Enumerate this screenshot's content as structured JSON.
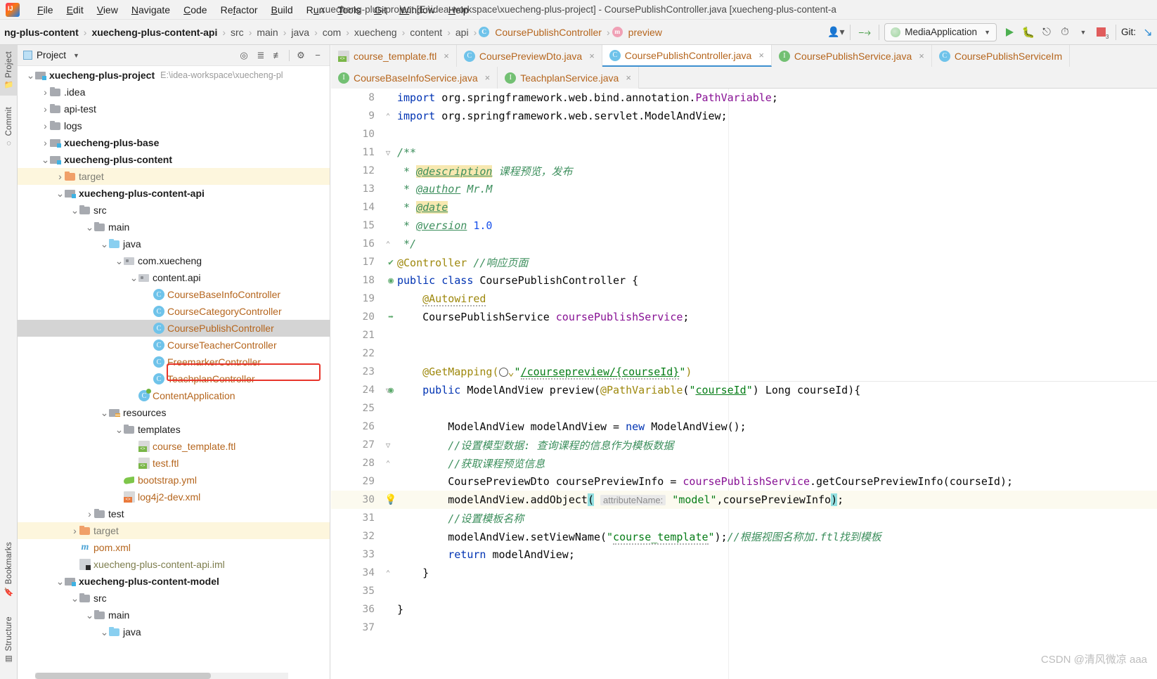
{
  "window": {
    "title": "xuecheng-plus-project [E:\\idea-workspace\\xuecheng-plus-project] - CoursePublishController.java [xuecheng-plus-content-a",
    "logo": "intellij-idea-logo"
  },
  "menubar": {
    "items": [
      "File",
      "Edit",
      "View",
      "Navigate",
      "Code",
      "Refactor",
      "Build",
      "Run",
      "Tools",
      "Git",
      "Window",
      "Help"
    ]
  },
  "breadcrumbs": [
    {
      "label": "ng-plus-content",
      "bold": true,
      "kind": "module"
    },
    {
      "label": "xuecheng-plus-content-api",
      "bold": true,
      "kind": "module"
    },
    {
      "label": "src",
      "bold": false,
      "kind": "dir"
    },
    {
      "label": "main",
      "bold": false,
      "kind": "dir"
    },
    {
      "label": "java",
      "bold": false,
      "kind": "dir"
    },
    {
      "label": "com",
      "bold": false,
      "kind": "dir"
    },
    {
      "label": "xuecheng",
      "bold": false,
      "kind": "dir"
    },
    {
      "label": "content",
      "bold": false,
      "kind": "dir"
    },
    {
      "label": "api",
      "bold": false,
      "kind": "dir"
    },
    {
      "label": "CoursePublishController",
      "bold": false,
      "kind": "class",
      "badge": "C"
    },
    {
      "label": "preview",
      "bold": false,
      "kind": "method",
      "badge": "m"
    }
  ],
  "toolbar": {
    "run_config": "MediaApplication",
    "run_button": "run-button",
    "debug_button": "debug-button",
    "coverage_button": "run-with-coverage-button",
    "profiler_button": "profiler-button",
    "stop_button": "stop-button",
    "stop_badge": "3",
    "git_label": "Git:",
    "update_project": "update-project-button",
    "user_icon": "user-avatar-icon",
    "build_icon": "build-hammer-icon"
  },
  "tool_stripe": {
    "items": [
      {
        "label": "Project",
        "active": true
      },
      {
        "label": "Commit",
        "active": false
      },
      {
        "label": "Bookmarks",
        "active": false
      },
      {
        "label": "Structure",
        "active": false
      }
    ]
  },
  "project_panel": {
    "title": "Project",
    "tools": [
      "locate-icon",
      "expand-all-icon",
      "collapse-all-icon",
      "settings-gear-icon",
      "hide-icon"
    ],
    "tree": [
      {
        "indent": 0,
        "arrow": "v",
        "icon": "module",
        "label": "xuecheng-plus-project",
        "bold": true,
        "path": "E:\\idea-workspace\\xuecheng-pl"
      },
      {
        "indent": 1,
        "arrow": ">",
        "icon": "folder",
        "label": ".idea"
      },
      {
        "indent": 1,
        "arrow": ">",
        "icon": "folder",
        "label": "api-test"
      },
      {
        "indent": 1,
        "arrow": ">",
        "icon": "folder",
        "label": "logs"
      },
      {
        "indent": 1,
        "arrow": ">",
        "icon": "module",
        "label": "xuecheng-plus-base",
        "bold": true
      },
      {
        "indent": 1,
        "arrow": "v",
        "icon": "module",
        "label": "xuecheng-plus-content",
        "bold": true
      },
      {
        "indent": 2,
        "arrow": ">",
        "icon": "folder-orange",
        "label": "target",
        "color": "grey",
        "highlight": "yellow"
      },
      {
        "indent": 2,
        "arrow": "v",
        "icon": "module",
        "label": "xuecheng-plus-content-api",
        "bold": true
      },
      {
        "indent": 3,
        "arrow": "v",
        "icon": "folder",
        "label": "src"
      },
      {
        "indent": 4,
        "arrow": "v",
        "icon": "folder",
        "label": "main"
      },
      {
        "indent": 5,
        "arrow": "v",
        "icon": "folder-blue",
        "label": "java"
      },
      {
        "indent": 6,
        "arrow": "v",
        "icon": "package",
        "label": "com.xuecheng"
      },
      {
        "indent": 7,
        "arrow": "v",
        "icon": "package",
        "label": "content.api"
      },
      {
        "indent": 8,
        "arrow": "",
        "icon": "class",
        "label": "CourseBaseInfoController",
        "color": "orange"
      },
      {
        "indent": 8,
        "arrow": "",
        "icon": "class",
        "label": "CourseCategoryController",
        "color": "orange"
      },
      {
        "indent": 8,
        "arrow": "",
        "icon": "class",
        "label": "CoursePublishController",
        "color": "orange",
        "selected": true,
        "boxed": true
      },
      {
        "indent": 8,
        "arrow": "",
        "icon": "class",
        "label": "CourseTeacherController",
        "color": "orange"
      },
      {
        "indent": 8,
        "arrow": "",
        "icon": "class",
        "label": "FreemarkerController",
        "color": "orange"
      },
      {
        "indent": 8,
        "arrow": "",
        "icon": "class",
        "label": "TeachplanController",
        "color": "orange"
      },
      {
        "indent": 7,
        "arrow": "",
        "icon": "spring-class",
        "label": "ContentApplication",
        "color": "orange"
      },
      {
        "indent": 5,
        "arrow": "v",
        "icon": "resources",
        "label": "resources"
      },
      {
        "indent": 6,
        "arrow": "v",
        "icon": "folder",
        "label": "templates"
      },
      {
        "indent": 7,
        "arrow": "",
        "icon": "ftl",
        "label": "course_template.ftl",
        "color": "orange"
      },
      {
        "indent": 7,
        "arrow": "",
        "icon": "ftl",
        "label": "test.ftl",
        "color": "orange"
      },
      {
        "indent": 6,
        "arrow": "",
        "icon": "yml",
        "label": "bootstrap.yml",
        "color": "orange"
      },
      {
        "indent": 6,
        "arrow": "",
        "icon": "ftl-orange",
        "label": "log4j2-dev.xml",
        "color": "orange"
      },
      {
        "indent": 4,
        "arrow": ">",
        "icon": "folder",
        "label": "test"
      },
      {
        "indent": 3,
        "arrow": ">",
        "icon": "folder-orange",
        "label": "target",
        "color": "grey",
        "highlight": "yellow"
      },
      {
        "indent": 3,
        "arrow": "",
        "icon": "maven",
        "label": "pom.xml",
        "color": "orange"
      },
      {
        "indent": 3,
        "arrow": "",
        "icon": "iml",
        "label": "xuecheng-plus-content-api.iml",
        "color": "olive"
      },
      {
        "indent": 2,
        "arrow": "v",
        "icon": "module",
        "label": "xuecheng-plus-content-model",
        "bold": true
      },
      {
        "indent": 3,
        "arrow": "v",
        "icon": "folder",
        "label": "src"
      },
      {
        "indent": 4,
        "arrow": "v",
        "icon": "folder",
        "label": "main"
      },
      {
        "indent": 5,
        "arrow": "v",
        "icon": "folder-blue",
        "label": "java"
      }
    ]
  },
  "editor_tabs": {
    "row1": [
      {
        "label": "course_template.ftl",
        "icon": "ftl",
        "active": false,
        "close": "×"
      },
      {
        "label": "CoursePreviewDto.java",
        "icon": "class",
        "active": false,
        "close": "×"
      },
      {
        "label": "CoursePublishController.java",
        "icon": "class",
        "active": true,
        "close": "×"
      },
      {
        "label": "CoursePublishService.java",
        "icon": "interface",
        "active": false,
        "close": "×"
      },
      {
        "label": "CoursePublishServiceIm",
        "icon": "class",
        "active": false,
        "close": ""
      }
    ],
    "row2": [
      {
        "label": "CourseBaseInfoService.java",
        "icon": "interface",
        "active": false,
        "close": "×"
      },
      {
        "label": "TeachplanService.java",
        "icon": "interface",
        "active": false,
        "close": "×"
      }
    ]
  },
  "code": {
    "lines": [
      {
        "n": "8",
        "text": "import org.springframework.web.bind.annotation.PathVariable;"
      },
      {
        "n": "9",
        "text": "import org.springframework.web.servlet.ModelAndView;"
      },
      {
        "n": "10",
        "text": ""
      },
      {
        "n": "11",
        "text": "/**"
      },
      {
        "n": "12",
        "text": " * @description 课程预览，发布"
      },
      {
        "n": "13",
        "text": " * @author Mr.M"
      },
      {
        "n": "14",
        "text": " * @date"
      },
      {
        "n": "15",
        "text": " * @version 1.0"
      },
      {
        "n": "16",
        "text": " */"
      },
      {
        "n": "17",
        "text": "@Controller //响应页面"
      },
      {
        "n": "18",
        "text": "public class CoursePublishController {"
      },
      {
        "n": "19",
        "text": "    @Autowired"
      },
      {
        "n": "20",
        "text": "    CoursePublishService coursePublishService;"
      },
      {
        "n": "21",
        "text": ""
      },
      {
        "n": "22",
        "text": ""
      },
      {
        "n": "23",
        "text": "    @GetMapping(\"/coursepreview/{courseId}\")"
      },
      {
        "n": "24",
        "text": "    public ModelAndView preview(@PathVariable(\"courseId\") Long courseId){"
      },
      {
        "n": "25",
        "text": ""
      },
      {
        "n": "26",
        "text": "        ModelAndView modelAndView = new ModelAndView();"
      },
      {
        "n": "27",
        "text": "        //设置模型数据: 查询课程的信息作为模板数据"
      },
      {
        "n": "28",
        "text": "        //获取课程预览信息"
      },
      {
        "n": "29",
        "text": "        CoursePreviewDto coursePreviewInfo = coursePublishService.getCoursePreviewInfo(courseId);"
      },
      {
        "n": "30",
        "text": "        modelAndView.addObject( attributeName: \"model\",coursePreviewInfo);"
      },
      {
        "n": "31",
        "text": "        //设置模板名称"
      },
      {
        "n": "32",
        "text": "        modelAndView.setViewName(\"course_template\");//根据视图名称加.ftl找到模板"
      },
      {
        "n": "33",
        "text": "        return modelAndView;"
      },
      {
        "n": "34",
        "text": "    }"
      },
      {
        "n": "35",
        "text": ""
      },
      {
        "n": "36",
        "text": "}"
      },
      {
        "n": "37",
        "text": ""
      }
    ],
    "parameter_hint": "attributeName:",
    "highlighted_line": "30"
  },
  "watermark": "CSDN @清风微凉 aaa"
}
